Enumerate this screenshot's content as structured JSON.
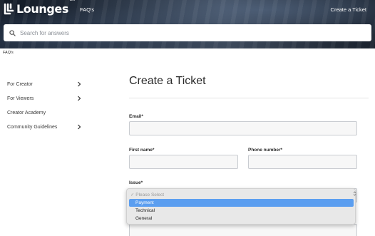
{
  "header": {
    "logo_text": "Lounges",
    "logo_tm": "TM",
    "nav_faqs": "FAQ's",
    "nav_create_ticket": "Create a Ticket"
  },
  "search": {
    "placeholder": "Search for answers",
    "value": ""
  },
  "breadcrumb": {
    "label": "FAQ's"
  },
  "sidebar": {
    "items": [
      {
        "label": "For Creator",
        "has_chevron": true,
        "icon": "chevron-right-icon"
      },
      {
        "label": "For Viewers",
        "has_chevron": true,
        "icon": "chevron-right-icon"
      },
      {
        "label": "Creator Academy",
        "has_chevron": false
      },
      {
        "label": "Community Guidelines",
        "has_chevron": true,
        "icon": "chevron-right-icon"
      }
    ]
  },
  "form": {
    "title": "Create a Ticket",
    "email_label": "Email*",
    "first_name_label": "First name*",
    "phone_label": "Phone number*",
    "issue_label": "Issue*",
    "email_value": "",
    "first_name_value": "",
    "phone_value": ""
  },
  "issue_dropdown": {
    "placeholder": "Please Select",
    "check_glyph": "✓",
    "options": [
      "Payment",
      "Technical",
      "General"
    ],
    "highlighted": "Payment"
  },
  "colors": {
    "highlight": "#5b9ef0",
    "field_bg": "#f7f7f7",
    "field_border": "#c9ccd1",
    "header_dark": "#1a222e"
  }
}
